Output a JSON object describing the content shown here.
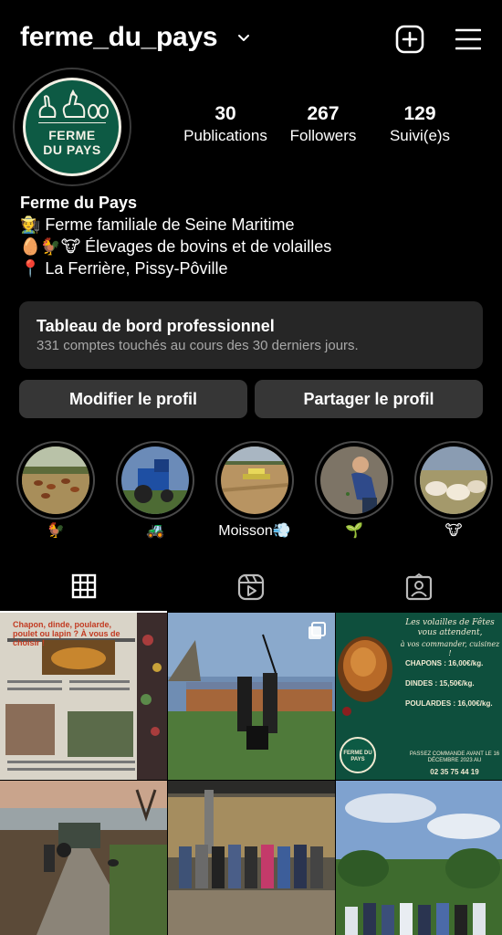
{
  "header": {
    "username": "ferme_du_pays",
    "icons": [
      "chevron-down-icon",
      "new-post-icon",
      "menu-icon"
    ]
  },
  "profile": {
    "avatar_text_line1": "FERME",
    "avatar_text_line2": "DU PAYS",
    "stats": [
      {
        "value": "30",
        "label": "Publications"
      },
      {
        "value": "267",
        "label": "Followers"
      },
      {
        "value": "129",
        "label": "Suivi(e)s"
      }
    ]
  },
  "bio": {
    "name": "Ferme du Pays",
    "lines": [
      "🧑‍🌾 Ferme familiale de Seine Maritime",
      "🥚🐓🐮 Élevages de bovins et de volailles",
      "📍 La Ferrière, Pissy-Pôville"
    ]
  },
  "dashboard": {
    "title": "Tableau de bord professionnel",
    "subtitle": "331 comptes touchés au cours des 30 derniers jours."
  },
  "actions": {
    "edit_profile": "Modifier le profil",
    "share_profile": "Partager le profil"
  },
  "highlights": [
    {
      "label": "🐓"
    },
    {
      "label": "🚜"
    },
    {
      "label": "Moisson💨"
    },
    {
      "label": "🌱"
    },
    {
      "label": "🐮"
    }
  ],
  "tabs": {
    "active": "grid",
    "items": [
      "grid-icon",
      "reels-icon",
      "tagged-icon"
    ]
  },
  "posts": {
    "newspaper_headline": "Chapon, dinde, poularde, poulet ou lapin ? À vous de choisir !",
    "promo": {
      "title": "Les volailles de Fêtes vous attendent,",
      "subtitle": "à vos commander, cuisinez !",
      "items": [
        "CHAPONS : 16,00€/kg.",
        "DINDES : 15,50€/kg.",
        "POULARDES : 16,00€/kg."
      ],
      "note": "PASSEZ COMMANDE AVANT LE 16 DÉCEMBRE 2023 AU",
      "phone": "02 35 75 44 19",
      "logo": "FERME DU PAYS"
    }
  },
  "colors": {
    "background": "#000000",
    "surface": "#262626",
    "button": "#363636",
    "brand_green": "#0d5a44",
    "muted_text": "#a8a8a8"
  }
}
